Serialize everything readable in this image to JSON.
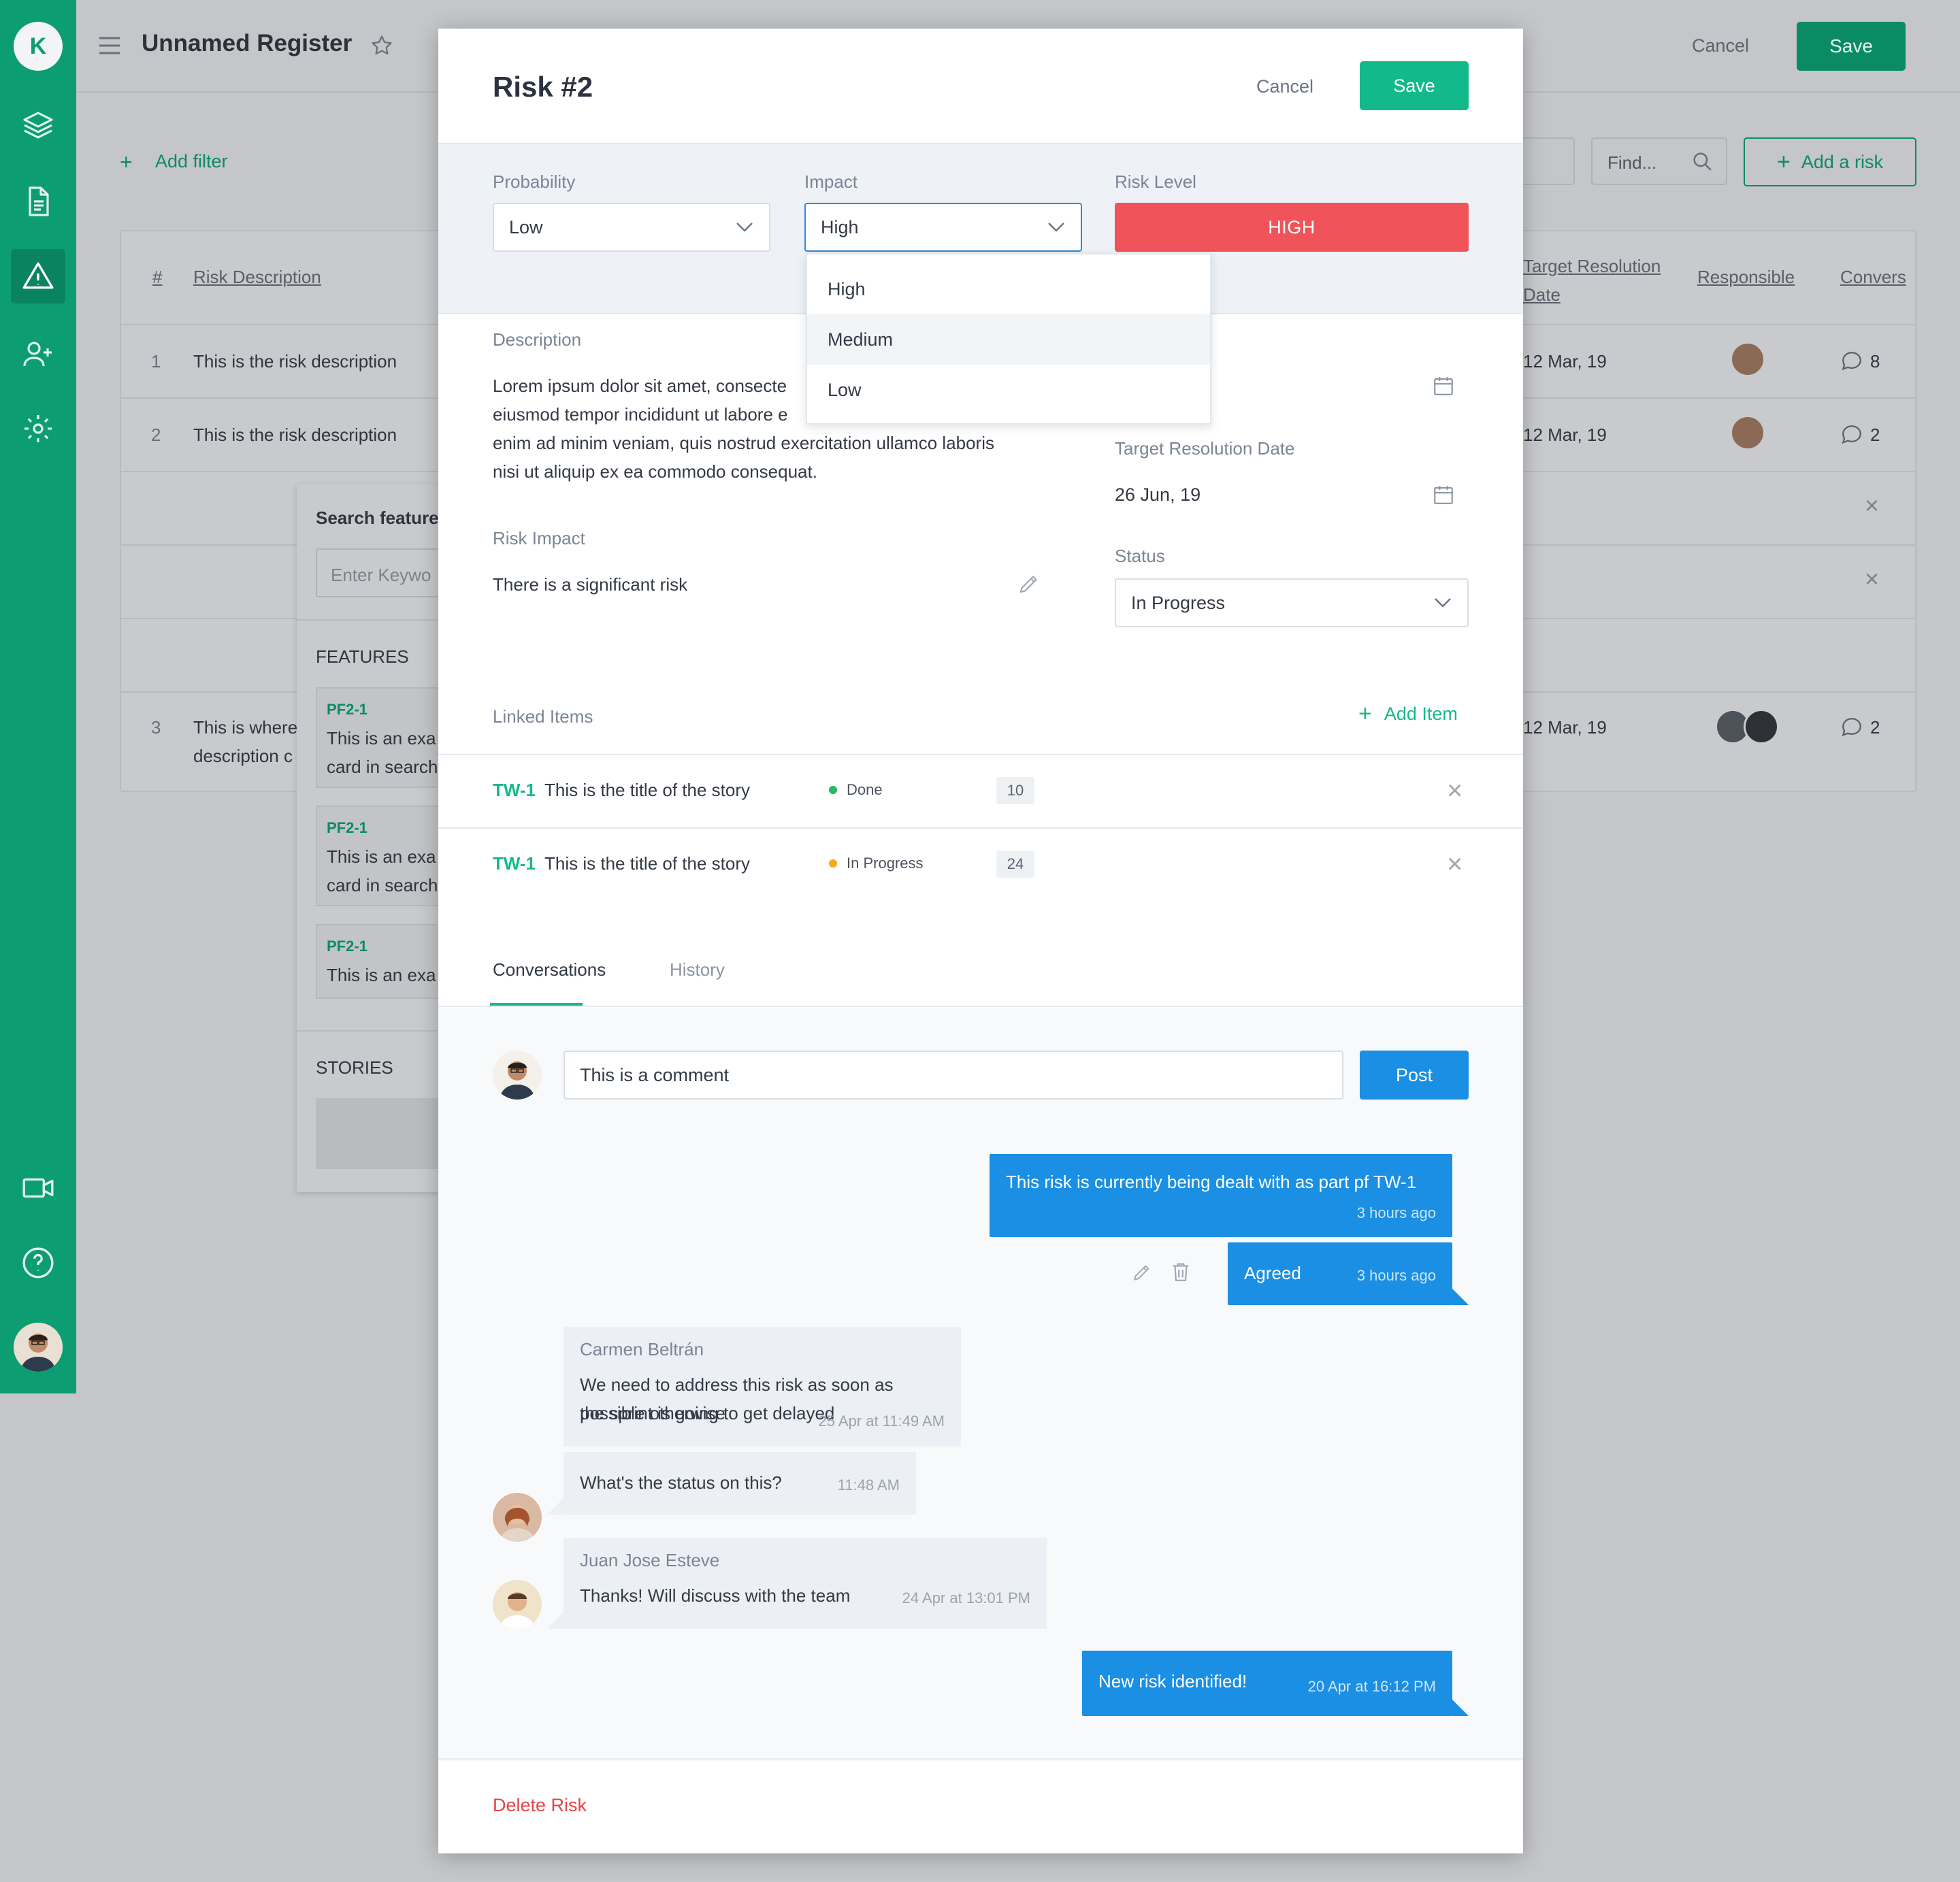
{
  "sidebar": {
    "logo_letter": "K",
    "icons": [
      "layers-icon",
      "document-icon",
      "warning-icon",
      "add-user-icon",
      "settings-icon",
      "video-icon",
      "help-icon"
    ]
  },
  "background_app": {
    "title": "Unnamed Register",
    "cancel_label": "Cancel",
    "save_label": "Save",
    "add_filter_label": "Add filter",
    "find_placeholder": "Find...",
    "add_risk_label": "Add a risk",
    "table": {
      "headers": [
        "#",
        "Risk Description",
        "Target Resolution Date",
        "Responsible",
        "Convers"
      ],
      "rows": [
        {
          "num": "1",
          "desc": "This is the risk description",
          "date": "12 Mar, 19",
          "comments": "8"
        },
        {
          "num": "2",
          "desc": "This is the risk description",
          "date": "12 Mar, 19",
          "comments": "2"
        },
        {
          "num": "3",
          "desc_line1": "This is where",
          "desc_line2": "description c",
          "date": "12 Mar, 19",
          "comments": "2"
        }
      ]
    },
    "search_panel": {
      "title": "Search feature",
      "placeholder": "Enter Keywo",
      "features_heading": "FEATURES",
      "cards": [
        {
          "key": "PF2-1",
          "line1": "This is an exa",
          "line2": "card in search"
        },
        {
          "key": "PF2-1",
          "line1": "This is an exa",
          "line2": "card in search"
        },
        {
          "key": "PF2-1",
          "line1": "This is an exa",
          "line2": ""
        }
      ],
      "stories_heading": "STORIES"
    }
  },
  "modal": {
    "title": "Risk #2",
    "cancel_label": "Cancel",
    "save_label": "Save",
    "probability": {
      "label": "Probability",
      "value": "Low"
    },
    "impact": {
      "label": "Impact",
      "value": "High",
      "options": [
        "High",
        "Medium",
        "Low"
      ],
      "highlighted": "Medium"
    },
    "risk_level": {
      "label": "Risk Level",
      "value": "HIGH",
      "color": "#f0535a"
    },
    "description": {
      "label": "Description",
      "lines": [
        "Lorem ipsum dolor sit amet, consecte",
        "eiusmod tempor incididunt ut labore e",
        "enim ad minim veniam, quis nostrud exercitation ullamco laboris",
        "nisi ut aliquip ex ea commodo consequat."
      ]
    },
    "risk_impact": {
      "label": "Risk Impact",
      "value": "There is a significant risk"
    },
    "target_resolution": {
      "label": "Target Resolution Date",
      "value": "26 Jun, 19"
    },
    "status": {
      "label": "Status",
      "value": "In Progress"
    },
    "linked_items": {
      "label": "Linked Items",
      "add_label": "Add Item",
      "items": [
        {
          "key": "TW-1",
          "title": "This is the title of the story",
          "status": "Done",
          "status_color": "#27b765",
          "count": "10"
        },
        {
          "key": "TW-1",
          "title": "This is the title of the story",
          "status": "In Progress",
          "status_color": "#f5a623",
          "count": "24"
        }
      ]
    },
    "tabs": [
      "Conversations",
      "History"
    ],
    "comment_input_value": "This is a comment",
    "post_label": "Post",
    "messages": [
      {
        "text": "This risk is currently being dealt with as part pf TW-1",
        "time": "3 hours ago"
      },
      {
        "text": "Agreed",
        "time": "3 hours ago"
      },
      {
        "author": "Carmen Beltrán",
        "line1": "We need to address this risk as soon as possible otherwise",
        "line2": "the sprint is going to get delayed",
        "time": "25 Apr at 11:49 AM"
      },
      {
        "text": "What's the status on this?",
        "time": "11:48 AM"
      },
      {
        "author": "Juan Jose Esteve",
        "text": "Thanks! Will discuss with the team",
        "time": "24 Apr at 13:01 PM"
      },
      {
        "text": "New risk identified!",
        "time": "20 Apr at 16:12 PM"
      }
    ],
    "delete_label": "Delete Risk"
  },
  "colors": {
    "brand": "#0d9d72",
    "accent": "#14b98b",
    "blue": "#1a8fe3",
    "danger": "#f0535a"
  }
}
